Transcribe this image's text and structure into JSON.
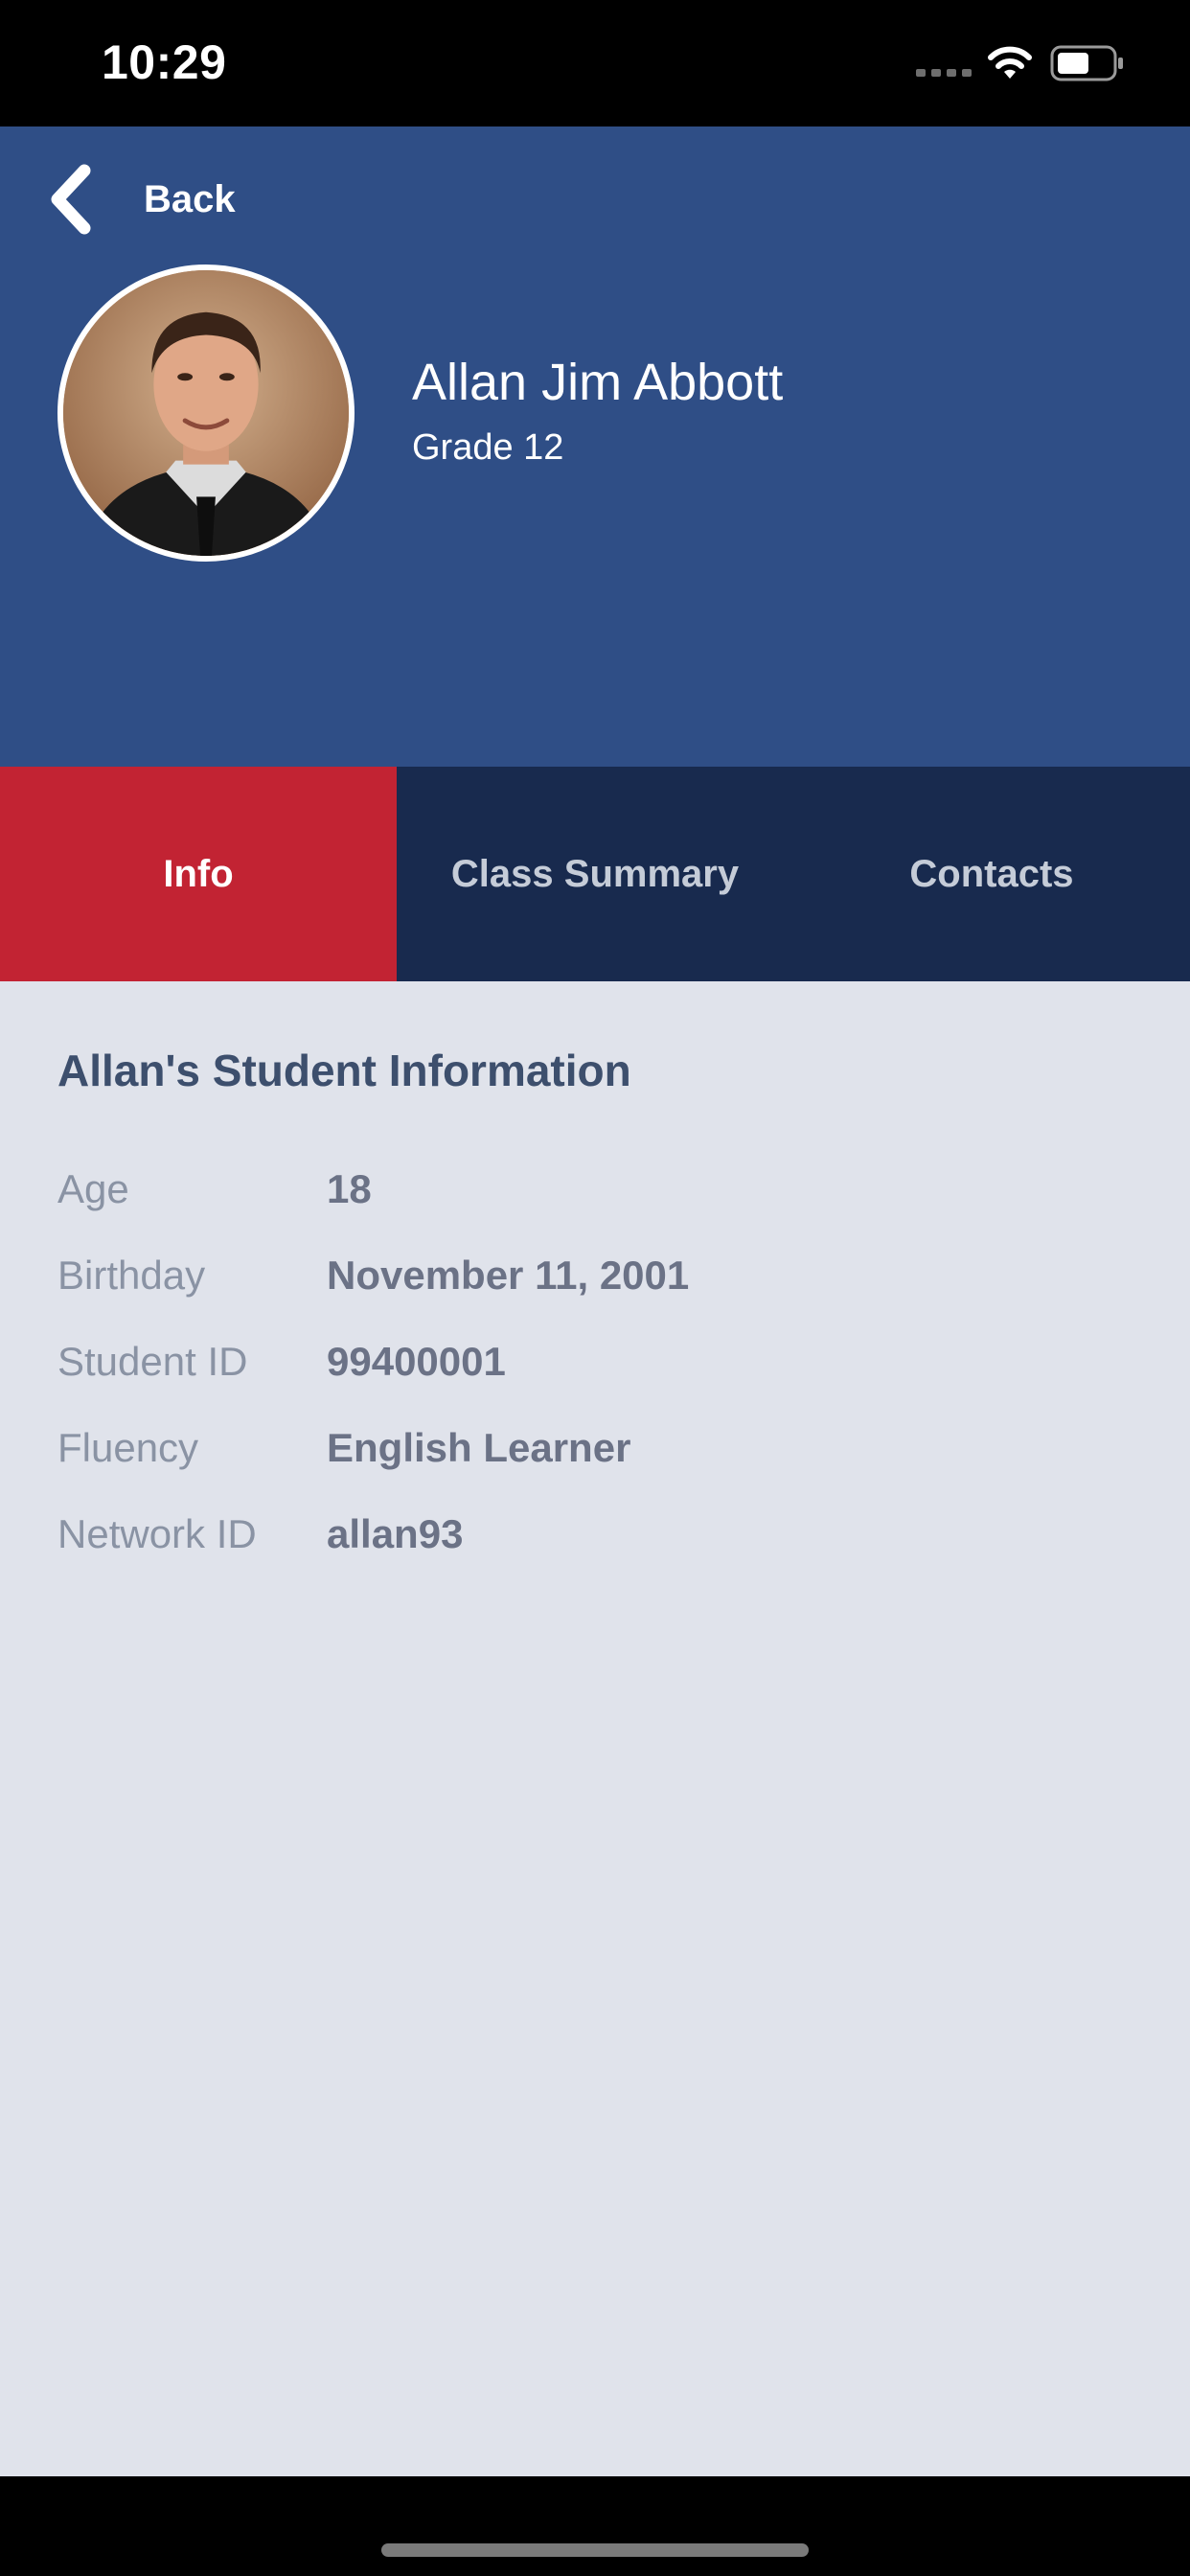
{
  "status_bar": {
    "time": "10:29",
    "icons": [
      "signal-icon",
      "wifi-icon",
      "battery-icon"
    ]
  },
  "header": {
    "back_label": "Back",
    "back_icon": "chevron-left-icon",
    "student_name": "Allan Jim Abbott",
    "student_grade": "Grade 12",
    "background_color": "#2f4e86"
  },
  "tabs": [
    {
      "label": "Info",
      "active": true
    },
    {
      "label": "Class Summary",
      "active": false
    },
    {
      "label": "Contacts",
      "active": false
    }
  ],
  "colors": {
    "active_tab": "#c22333",
    "inactive_tab": "#182a4e",
    "content_background": "#e0e3eb"
  },
  "info": {
    "title": "Allan's Student Information",
    "rows": [
      {
        "label": "Age",
        "value": "18"
      },
      {
        "label": "Birthday",
        "value": "November 11, 2001"
      },
      {
        "label": "Student ID",
        "value": "99400001"
      },
      {
        "label": "Fluency",
        "value": "English Learner"
      },
      {
        "label": "Network ID",
        "value": "allan93"
      }
    ]
  }
}
